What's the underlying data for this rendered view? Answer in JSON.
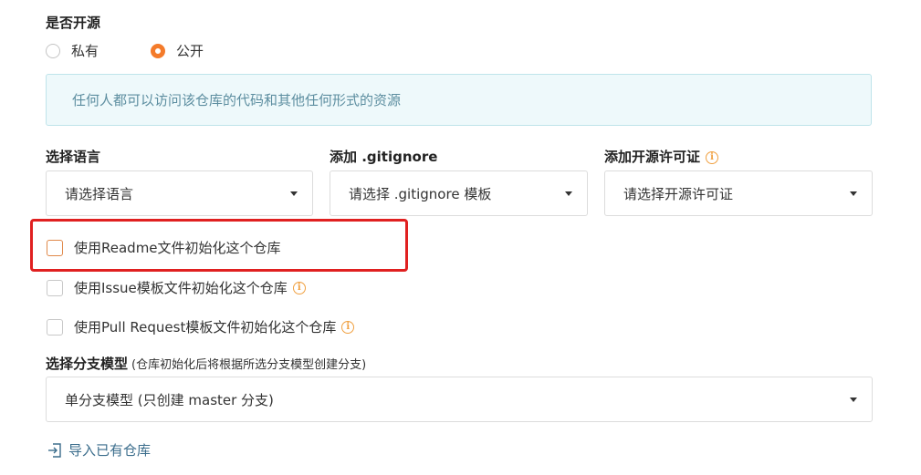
{
  "visibility": {
    "label": "是否开源",
    "options": [
      {
        "label": "私有",
        "selected": false
      },
      {
        "label": "公开",
        "selected": true
      }
    ],
    "notice": "任何人都可以访问该仓库的代码和其他任何形式的资源"
  },
  "language": {
    "label": "选择语言",
    "placeholder": "请选择语言"
  },
  "gitignore": {
    "label": "添加 .gitignore",
    "placeholder": "请选择 .gitignore 模板"
  },
  "license": {
    "label": "添加开源许可证",
    "placeholder": "请选择开源许可证",
    "icon": "info-icon"
  },
  "init_options": [
    {
      "label": "使用Readme文件初始化这个仓库",
      "checked": false,
      "has_info": false
    },
    {
      "label": "使用Issue模板文件初始化这个仓库",
      "checked": false,
      "has_info": true
    },
    {
      "label": "使用Pull Request模板文件初始化这个仓库",
      "checked": false,
      "has_info": true
    }
  ],
  "branch_model": {
    "label": "选择分支模型",
    "hint": "(仓库初始化后将根据所选分支模型创建分支)",
    "selected": "单分支模型 (只创建 master 分支)"
  },
  "import": {
    "label": "导入已有仓库",
    "icon": "import-icon"
  },
  "colors": {
    "accent": "#f47b2a",
    "highlight_frame": "#e02020",
    "info": "#f0a040",
    "notice_bg": "#eef9fb"
  }
}
